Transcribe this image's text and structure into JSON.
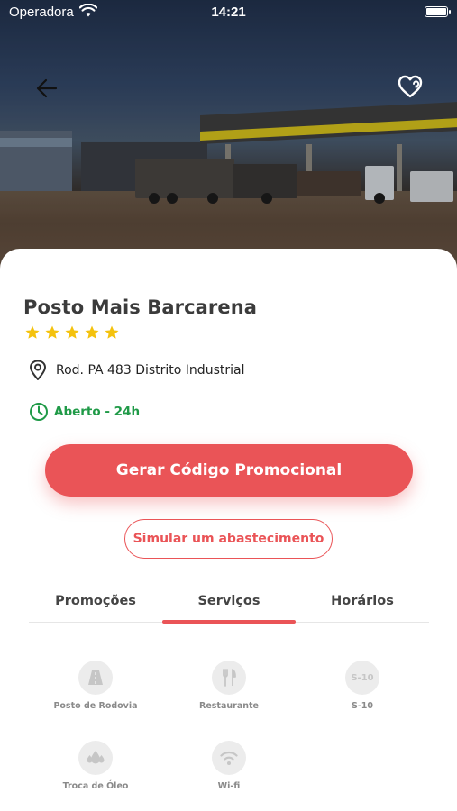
{
  "status_bar": {
    "carrier": "Operadora",
    "time": "14:21"
  },
  "hero": {
    "image_description": "gas-station-photo",
    "back_icon": "arrow-left-icon",
    "favorite_icon": "heart-icon"
  },
  "station": {
    "name": "Posto Mais Barcarena",
    "rating": 5,
    "rating_max": 5,
    "address": "Rod. PA 483 Distrito Industrial",
    "hours": "Aberto - 24h"
  },
  "actions": {
    "promo_label": "Gerar Código Promocional",
    "simulate_label": "Simular um abastecimento"
  },
  "tabs": [
    {
      "label": "Promoções",
      "active": false
    },
    {
      "label": "Serviços",
      "active": true
    },
    {
      "label": "Horários",
      "active": false
    }
  ],
  "services": [
    {
      "label": "Posto de Rodovia",
      "icon": "road-icon"
    },
    {
      "label": "Restaurante",
      "icon": "cutlery-icon"
    },
    {
      "label": "S-10",
      "icon": "s10-icon",
      "icon_text": "S-10"
    },
    {
      "label": "Troca de Óleo",
      "icon": "oil-drop-icon"
    },
    {
      "label": "Wi-fi",
      "icon": "wifi-icon"
    }
  ],
  "colors": {
    "accent": "#ea5457",
    "open_green": "#1f9a47",
    "star": "#f4c20d",
    "icon_bg": "#ececec",
    "icon_fg": "#c6c6c6"
  }
}
